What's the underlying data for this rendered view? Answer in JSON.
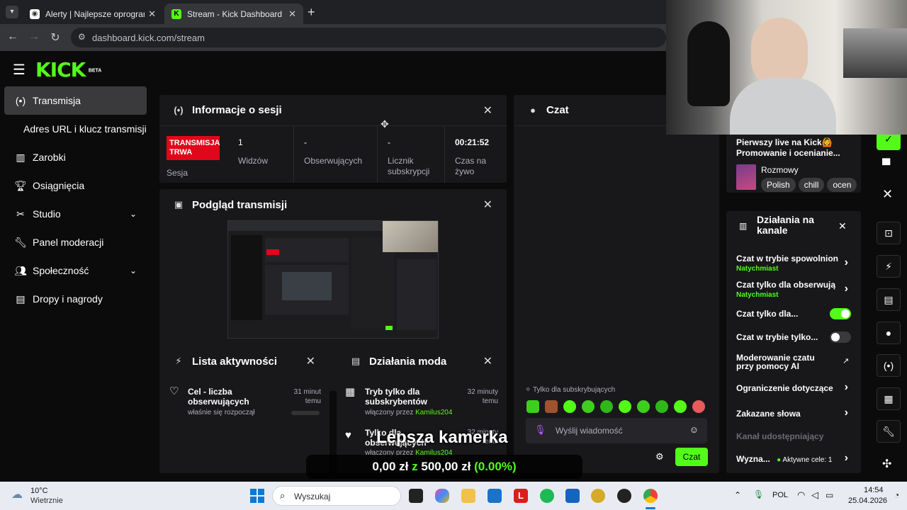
{
  "browser": {
    "tabs": [
      {
        "title": "Alerty | Najlepsze oprogramow",
        "active": false
      },
      {
        "title": "Stream - Kick Dashboard",
        "active": true
      }
    ],
    "url": "dashboard.kick.com/stream"
  },
  "brand": {
    "logo": "KICK",
    "badge": "BETA",
    "accent": "#53fc18"
  },
  "sidebar": {
    "items": [
      {
        "label": "Transmisja",
        "icon": "broadcast-icon"
      },
      {
        "label": "Adres URL i klucz transmisji",
        "icon": ""
      },
      {
        "label": "Zarobki",
        "icon": "chart-icon"
      },
      {
        "label": "Osiągnięcia",
        "icon": "trophy-icon"
      },
      {
        "label": "Studio",
        "icon": "clapper-icon"
      },
      {
        "label": "Panel moderacji",
        "icon": "wrench-icon"
      },
      {
        "label": "Społeczność",
        "icon": "people-icon"
      },
      {
        "label": "Dropy i nagrody",
        "icon": "gift-icon"
      }
    ]
  },
  "session": {
    "title": "Informacje o sesji",
    "live_badge_line1": "TRANSMISJA",
    "live_badge_line2": "TRWA",
    "live_label": "Sesja",
    "stats": [
      {
        "value": "1",
        "label": "Widzów"
      },
      {
        "value": "-",
        "label": "Obserwujących"
      },
      {
        "value": "-",
        "label": "Licznik subskrypcji"
      },
      {
        "value": "00:21:52",
        "label": "Czas na żywo"
      }
    ]
  },
  "preview": {
    "title": "Podgląd transmisji"
  },
  "activity": {
    "title": "Lista aktywności",
    "item_title": "Cel - liczba obserwujących",
    "item_sub": "właśnie się rozpoczął",
    "item_time": "31 minut temu"
  },
  "modactions": {
    "title": "Działania moda",
    "items": [
      {
        "title": "Tryb tylko dla subskrybentów",
        "by_prefix": "włączony przez",
        "by": "Kamilus204",
        "time": "32 minuty temu"
      },
      {
        "title": "Tylko dla obserwujących",
        "by_prefix": "włączony przez",
        "by": "Kamilus204",
        "time": "32 minuty temu"
      }
    ]
  },
  "chat": {
    "title": "Czat",
    "subs_only": "Tylko dla subskrybujących",
    "placeholder": "Wyślij wiadomość",
    "send_label": "Czat"
  },
  "stream_info": {
    "title": "Pierwszy live na Kick🙆 Promowanie i ocenianie...",
    "category": "Rozmowy",
    "tags": [
      "Polish",
      "chill",
      "ocen"
    ]
  },
  "channel_actions": {
    "title": "Działania na kanale",
    "rows": [
      {
        "label": "Czat w trybie spowolnion",
        "sub": "Natychmiast",
        "kind": "arrow"
      },
      {
        "label": "Czat tylko dla obserwują",
        "sub": "Natychmiast",
        "kind": "arrow"
      },
      {
        "label": "Czat tylko dla...",
        "sub": "",
        "kind": "toggle-on"
      },
      {
        "label": "Czat w trybie tylko...",
        "sub": "",
        "kind": "toggle-off"
      },
      {
        "label": "Moderowanie czatu przy pomocy AI",
        "sub": "",
        "kind": "external"
      },
      {
        "label": "Ograniczenie dotyczące",
        "sub": "",
        "kind": "arrow"
      },
      {
        "label": "Zakazane słowa",
        "sub": "",
        "kind": "arrow"
      },
      {
        "label": "Kanał udostępniający",
        "sub": "",
        "kind": "disabled"
      },
      {
        "label": "Wyzna...",
        "sub": "Aktywne cele: 1",
        "kind": "arrow"
      }
    ]
  },
  "overlay": {
    "caption": "Lepsza kamerka",
    "goal_current": "0,00 zł",
    "goal_sep": "z",
    "goal_total": "500,00 zł",
    "goal_pct": "(0.00%)"
  },
  "taskbar": {
    "weather_temp": "10°C",
    "weather_desc": "Wietrznie",
    "search_placeholder": "Wyszukaj",
    "lang": "POL",
    "time": "14:54",
    "date": "25.04.2026"
  }
}
